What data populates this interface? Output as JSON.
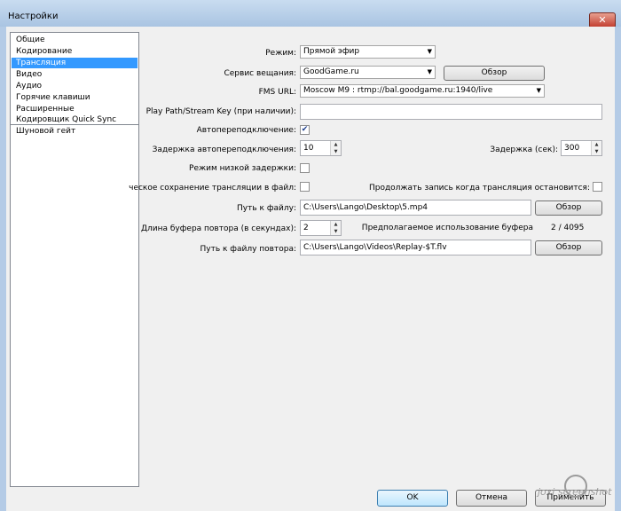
{
  "window": {
    "title": "Настройки",
    "close_glyph": "✕"
  },
  "sidebar": {
    "items": [
      {
        "label": "Общие"
      },
      {
        "label": "Кодирование"
      },
      {
        "label": "Трансляция",
        "selected": true
      },
      {
        "label": "Видео"
      },
      {
        "label": "Аудио"
      },
      {
        "label": "Горячие клавиши"
      },
      {
        "label": "Расширенные"
      },
      {
        "label": "Кодировщик Quick Sync"
      },
      {
        "label": "Шуновой гейт"
      }
    ]
  },
  "form": {
    "mode_label": "Режим:",
    "mode_value": "Прямой эфир",
    "service_label": "Сервис вещания:",
    "service_value": "GoodGame.ru",
    "browse_label": "Обзор",
    "fms_label": "FMS URL:",
    "fms_value": "Moscow M9     : rtmp://bal.goodgame.ru:1940/live",
    "playpath_label": "Play Path/Stream Key (при наличии):",
    "playpath_value": "",
    "autoreconnect_label": "Автопереподключение:",
    "autoreconnect_checked": true,
    "reconnect_delay_label": "Задержка автопереподключения:",
    "reconnect_delay_value": "10",
    "delay_label": "Задержка (сек):",
    "delay_value": "300",
    "lowlatency_label": "Режим низкой задержки:",
    "autosave_label": "ческое сохранение трансляции в файл:",
    "keeprecording_label": "Продолжать запись когда трансляция остановится:",
    "filepath_label": "Путь к файлу:",
    "filepath_value": "C:\\Users\\Lango\\Desktop\\5.mp4",
    "replaybuffer_label": "Длина буфера повтора (в секундах):",
    "replaybuffer_value": "2",
    "bufferusage_label": "Предполагаемое использование буфера",
    "bufferusage_value": "2 / 4095",
    "replaypath_label": "Путь к файлу повтора:",
    "replaypath_value": "C:\\Users\\Lango\\Videos\\Replay-$T.flv"
  },
  "footer": {
    "ok_label": "OK",
    "cancel_label": "Отмена",
    "apply_label": "Применить"
  },
  "watermark": {
    "text": "joxi screenshot"
  },
  "colors": {
    "selection": "#3399ff",
    "titlebar": "#b4cbe6"
  }
}
